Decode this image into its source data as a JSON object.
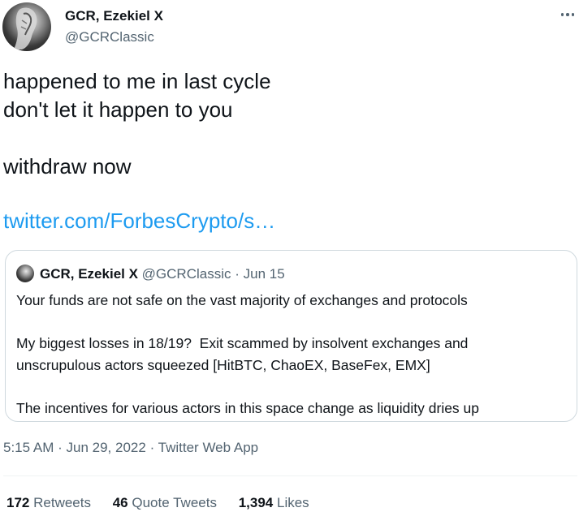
{
  "author": {
    "name": "GCR, Ezekiel X",
    "handle": "@GCRClassic"
  },
  "tweet": {
    "lines": [
      "happened to me in last cycle",
      "don't let it happen to you",
      "",
      "withdraw now"
    ],
    "link_text": "twitter.com/ForbesCrypto/s…"
  },
  "quoted": {
    "name": "GCR, Ezekiel X",
    "handle": "@GCRClassic",
    "separator": "·",
    "date": "Jun 15",
    "lines": [
      "Your funds are not safe on the vast majority of exchanges and protocols",
      "",
      "My biggest losses in 18/19?  Exit scammed by insolvent exchanges and",
      "unscrupulous actors squeezed [HitBTC, ChaoEX, BaseFex, EMX]",
      "",
      "The incentives for various actors in this space change as liquidity dries up"
    ]
  },
  "meta": {
    "time": "5:15 AM",
    "separator": "·",
    "date": "Jun 29, 2022",
    "source": "Twitter Web App"
  },
  "stats": [
    {
      "count": "172",
      "label": "Retweets"
    },
    {
      "count": "46",
      "label": "Quote Tweets"
    },
    {
      "count": "1,394",
      "label": "Likes"
    }
  ],
  "icons": {
    "more": "more-horizontal-icon"
  }
}
